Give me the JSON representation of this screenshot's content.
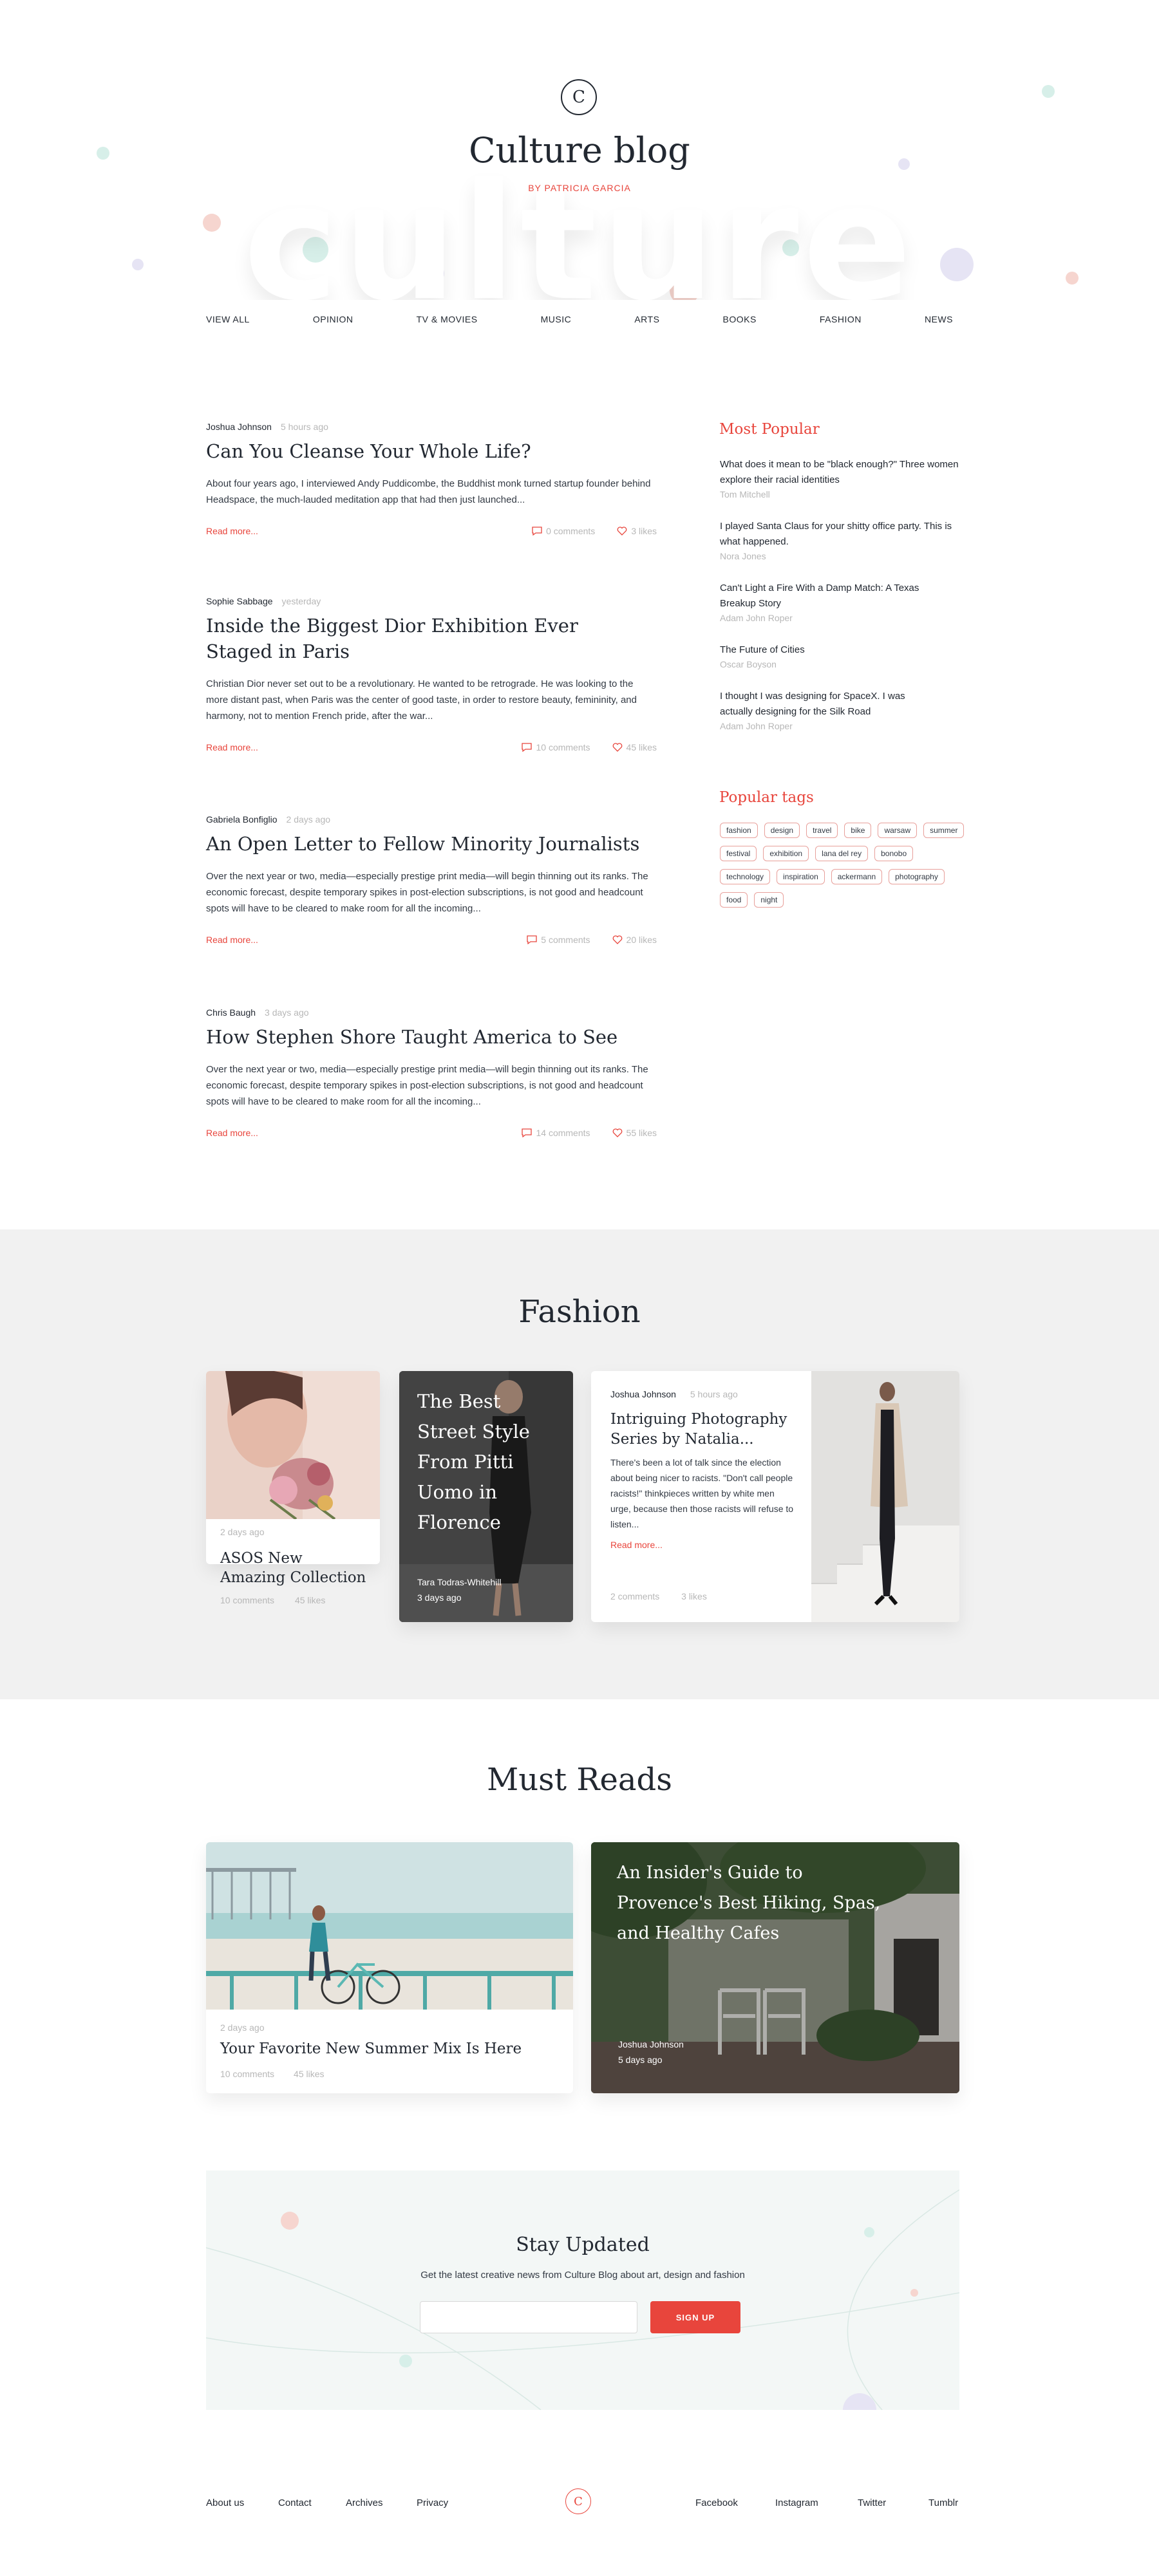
{
  "header": {
    "logo_letter": "C",
    "title": "Culture blog",
    "byline": "BY PATRICIA GARCIA",
    "bg_word": "culture"
  },
  "nav": [
    "VIEW ALL",
    "OPINION",
    "TV & MOVIES",
    "MUSIC",
    "ARTS",
    "BOOKS",
    "FASHION",
    "NEWS"
  ],
  "articles": [
    {
      "author": "Joshua Johnson",
      "time": "5 hours ago",
      "title": "Can You Cleanse Your Whole Life?",
      "excerpt": "About four years ago, I interviewed Andy Puddicombe, the Buddhist monk turned startup founder behind Headspace, the much-lauded meditation app that had then just launched...",
      "read_more": "Read more...",
      "comments": "0 comments",
      "likes": "3 likes"
    },
    {
      "author": "Sophie Sabbage",
      "time": "yesterday",
      "title": "Inside the Biggest Dior Exhibition Ever Staged in Paris",
      "excerpt": "Christian Dior never set out to be a revolutionary. He wanted to be retrograde. He was looking to the more distant past, when Paris was the center of good taste, in order to restore beauty, femininity, and harmony, not to mention French pride, after the war...",
      "read_more": "Read more...",
      "comments": "10 comments",
      "likes": "45 likes"
    },
    {
      "author": "Gabriela Bonfiglio",
      "time": "2 days ago",
      "title": "An Open Letter to Fellow Minority Journalists",
      "excerpt": "Over the next year or two, media—especially prestige print media—will begin thinning out its ranks. The economic forecast, despite temporary spikes in post-election subscriptions, is not good and headcount spots will have to be cleared to make room for all the incoming...",
      "read_more": "Read more...",
      "comments": "5 comments",
      "likes": "20 likes"
    },
    {
      "author": "Chris Baugh",
      "time": "3 days ago",
      "title": "How Stephen Shore Taught America to See",
      "excerpt": "Over the next year or two, media—especially prestige print media—will begin thinning out its ranks. The economic forecast, despite temporary spikes in post-election subscriptions, is not good and headcount spots will have to be cleared to make room for all the incoming...",
      "read_more": "Read more...",
      "comments": "14 comments",
      "likes": "55 likes"
    }
  ],
  "sidebar": {
    "popular_heading": "Most Popular",
    "popular": [
      {
        "title": "What does it mean to be \"black enough?\" Three women explore their racial identities",
        "author": "Tom Mitchell"
      },
      {
        "title": "I played Santa Claus for your shitty office party. This is what happened.",
        "author": "Nora Jones"
      },
      {
        "title": "Can't Light a Fire With a Damp Match: A Texas Breakup Story",
        "author": "Adam John Roper"
      },
      {
        "title": "The Future of Cities",
        "author": "Oscar Boyson"
      },
      {
        "title": "I thought I was designing for SpaceX. I was actually designing for the Silk Road",
        "author": "Adam John Roper"
      }
    ],
    "tags_heading": "Popular tags",
    "tags": [
      "fashion",
      "design",
      "travel",
      "bike",
      "warsaw",
      "summer",
      "festival",
      "exhibition",
      "lana del rey",
      "bonobo",
      "technology",
      "inspiration",
      "ackermann",
      "photography",
      "food",
      "night"
    ]
  },
  "fashion": {
    "title": "Fashion",
    "card1": {
      "time": "2 days ago",
      "title": "ASOS New Amazing Collection",
      "comments": "10 comments",
      "likes": "45 likes"
    },
    "card2": {
      "title": "The Best Street Style From Pitti Uomo in Florence",
      "author": "Tara Todras-Whitehill",
      "time": "3 days ago"
    },
    "card3": {
      "author": "Joshua Johnson",
      "time": "5 hours ago",
      "title": "Intriguing Photography Series by Natalia...",
      "excerpt": "There's been a lot of talk since the election about being nicer to racists. \"Don't call people racists!\" thinkpieces written by white men urge, because then those racists will refuse to listen...",
      "read_more": "Read more...",
      "comments": "2 comments",
      "likes": "3 likes"
    }
  },
  "must_reads": {
    "title": "Must Reads",
    "card1": {
      "time": "2 days ago",
      "title": "Your Favorite New Summer Mix Is Here",
      "comments": "10 comments",
      "likes": "45 likes"
    },
    "card2": {
      "title": "An Insider's Guide to Provence's Best Hiking, Spas, and Healthy Cafes",
      "author": "Joshua Johnson",
      "time": "5 days ago"
    }
  },
  "newsletter": {
    "title": "Stay Updated",
    "subtitle": "Get the latest creative news from Culture Blog about art, design and fashion",
    "placeholder": "",
    "button": "SIGN UP"
  },
  "footer": {
    "left_links": [
      "About us",
      "Contact",
      "Archives",
      "Privacy"
    ],
    "logo_letter": "C",
    "right_links": [
      "Facebook",
      "Instagram",
      "Twitter",
      "Tumblr"
    ]
  },
  "colors": {
    "accent": "#e8453c",
    "text": "#222831",
    "muted": "#b7b7b7",
    "section_bg": "#f1f1f1",
    "newsletter_bg": "#f3f7f6"
  }
}
